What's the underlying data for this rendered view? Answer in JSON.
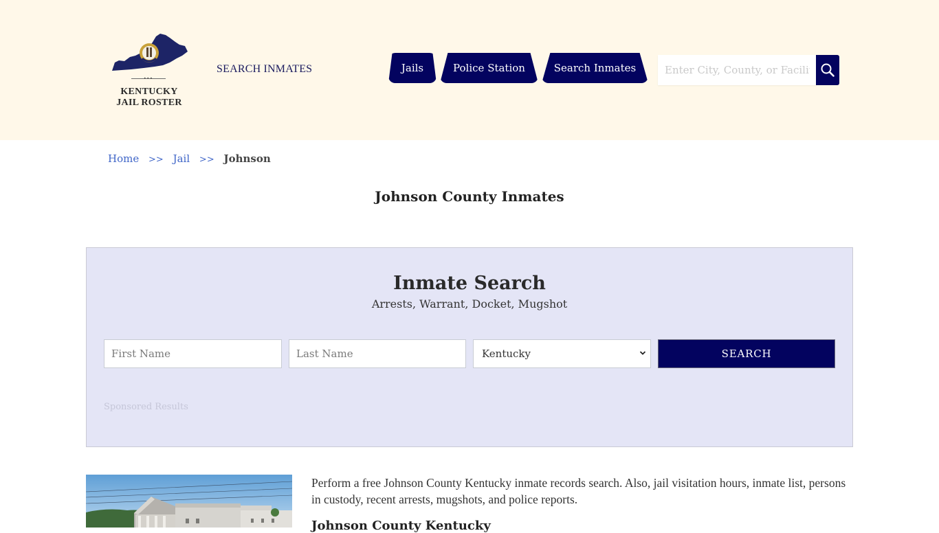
{
  "header": {
    "logo": {
      "line1": "KENTUCKY",
      "line2": "JAIL ROSTER",
      "dots": "•••",
      "icon": "kentucky-state-seal-map"
    },
    "search_inmates_link": "SEARCH INMATES",
    "nav_tabs": [
      {
        "label": "Jails"
      },
      {
        "label": "Police Station"
      },
      {
        "label": "Search Inmates"
      }
    ],
    "search": {
      "placeholder": "Enter City, County, or Facility",
      "value": "",
      "button_icon": "magnifier-icon"
    }
  },
  "breadcrumb": {
    "items": [
      {
        "label": "Home"
      },
      {
        "label": "Jail"
      }
    ],
    "separator": ">>",
    "current": "Johnson"
  },
  "page_title": "Johnson County Inmates",
  "inmate_search": {
    "title": "Inmate Search",
    "subtitle": "Arrests, Warrant, Docket, Mugshot",
    "first_name_placeholder": "First Name",
    "last_name_placeholder": "Last Name",
    "state_selected": "Kentucky",
    "search_button": "SEARCH",
    "sponsored_label": "Sponsored Results"
  },
  "content": {
    "intro": "Perform a free Johnson County Kentucky inmate records search. Also, jail visitation hours, inmate list, persons in custody, recent arrests, mugshots, and police reports.",
    "heading": "Johnson County Kentucky",
    "photo_alt": "Johnson County Jail building"
  },
  "colors": {
    "brand_navy": "#03035f",
    "header_bg": "#fff8e9",
    "panel_bg": "#e4e5f6",
    "link_blue": "#4066c8"
  }
}
